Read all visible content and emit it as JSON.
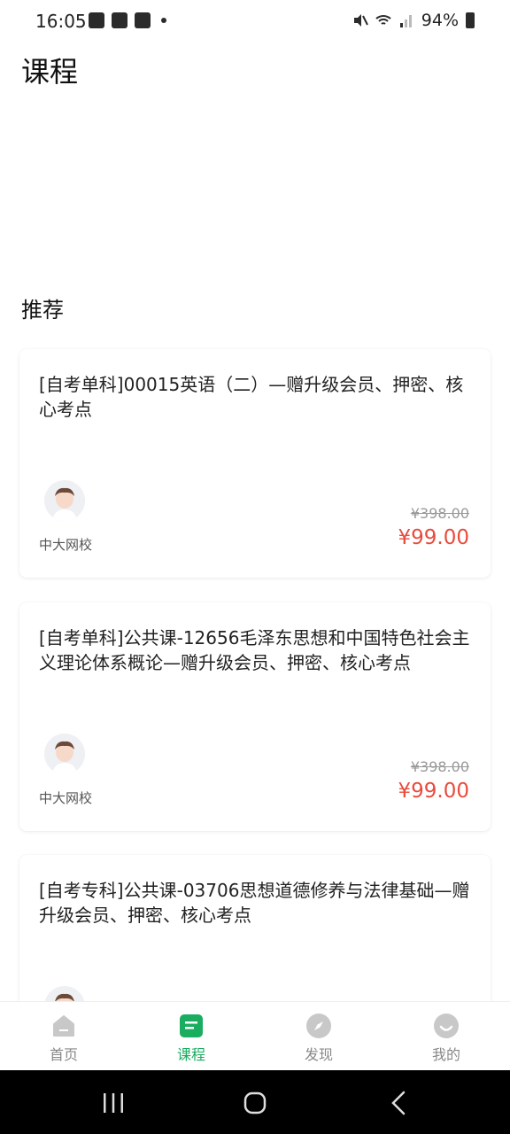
{
  "status": {
    "time": "16:05",
    "battery": "94%"
  },
  "page": {
    "title": "课程",
    "section": "推荐"
  },
  "courses": [
    {
      "title": "[自考单科]00015英语（二）—赠升级会员、押密、核心考点",
      "school": "中大网校",
      "orig_price": "¥398.00",
      "price": "¥99.00"
    },
    {
      "title": "[自考单科]公共课-12656毛泽东思想和中国特色社会主义理论体系概论—赠升级会员、押密、核心考点",
      "school": "中大网校",
      "orig_price": "¥398.00",
      "price": "¥99.00"
    },
    {
      "title": "[自考专科]公共课-03706思想道德修养与法律基础—赠升级会员、押密、核心考点"
    }
  ],
  "tabs": [
    {
      "label": "首页",
      "icon": "home-icon"
    },
    {
      "label": "课程",
      "icon": "course-icon"
    },
    {
      "label": "发现",
      "icon": "compass-icon"
    },
    {
      "label": "我的",
      "icon": "profile-icon"
    }
  ],
  "colors": {
    "accent": "#1aad5f",
    "price": "#e84c3d",
    "inactive": "#c8c8c8"
  }
}
